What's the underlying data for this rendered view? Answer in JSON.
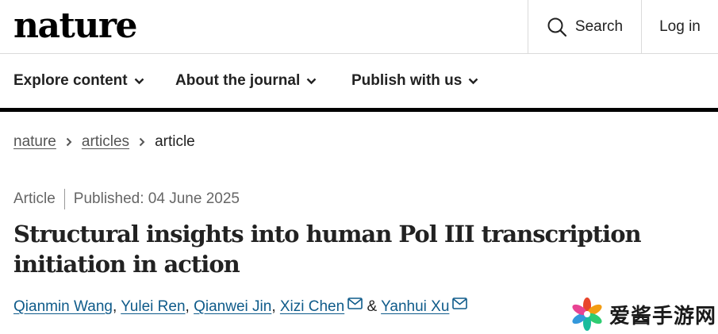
{
  "header": {
    "logo": "nature",
    "search_label": "Search",
    "login_label": "Log in"
  },
  "nav": {
    "items": [
      {
        "label": "Explore content"
      },
      {
        "label": "About the journal"
      },
      {
        "label": "Publish with us"
      }
    ]
  },
  "breadcrumb": {
    "items": [
      "nature",
      "articles",
      "article"
    ]
  },
  "article": {
    "type": "Article",
    "published": "Published: 04 June 2025",
    "title": "Structural insights into human Pol III transcription initiation in action",
    "authors": [
      "Qianmin Wang",
      "Yulei Ren",
      "Qianwei Jin",
      "Xizi Chen",
      "Yanhui Xu"
    ],
    "author_separator": ", ",
    "author_conjunction": "&"
  },
  "watermark": {
    "text": "爱酱手游网"
  },
  "colors": {
    "link": "#0f5b8a",
    "nav_rule": "#000000",
    "border": "#dadada"
  },
  "icons": [
    "search-icon",
    "chevron-down-icon",
    "chevron-right-icon",
    "mail-icon",
    "flower-logo-icon"
  ]
}
